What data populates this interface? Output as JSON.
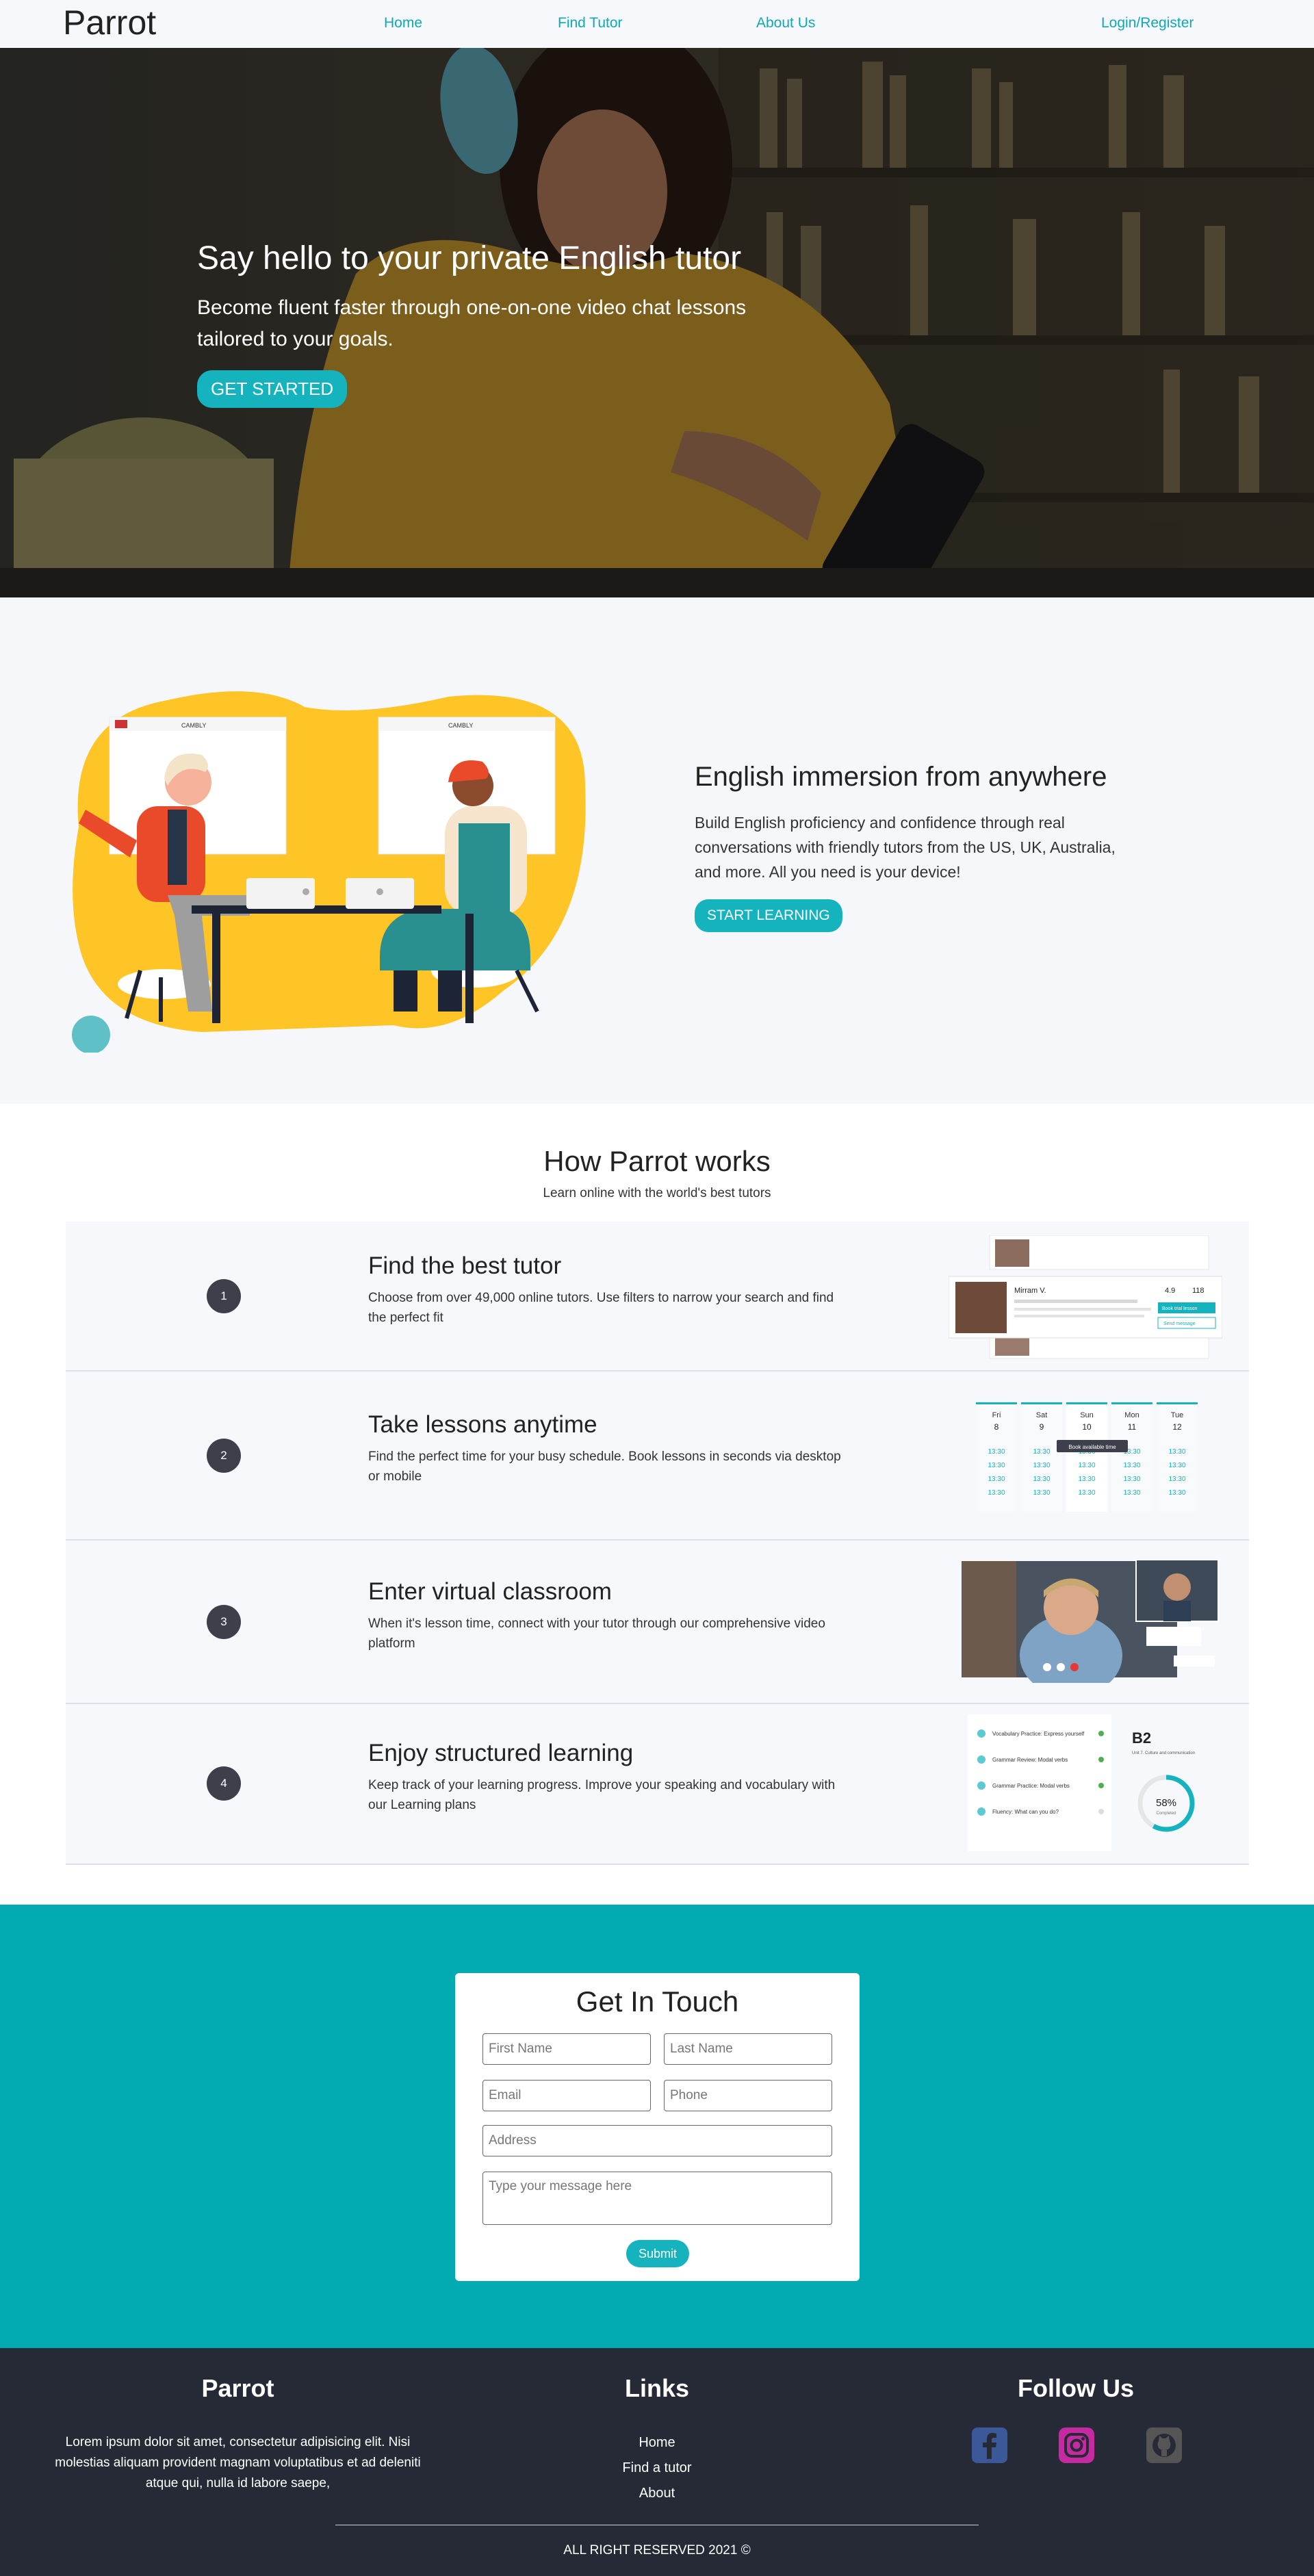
{
  "nav": {
    "brand": "Parrot",
    "home": "Home",
    "find_tutor": "Find Tutor",
    "about": "About Us",
    "login": "Login/Register"
  },
  "hero": {
    "title": "Say hello to your private English tutor",
    "subtitle": "Become fluent faster through one-on-one video chat lessons tailored to your goals.",
    "cta": "GET STARTED"
  },
  "immersion": {
    "title": "English immersion from anywhere",
    "text": "Build English proficiency and confidence through real conversations with friendly tutors from the US, UK, Australia, and more. All you need is your device!",
    "cta": "START LEARNING",
    "window_brand": "CAMBLY"
  },
  "how": {
    "title": "How Parrot works",
    "subtitle": "Learn online with the world's best tutors",
    "steps": [
      {
        "num": "1",
        "title": "Find the best tutor",
        "desc": "Choose from over 49,000 online tutors. Use filters to narrow your search and find the perfect fit"
      },
      {
        "num": "2",
        "title": "Take lessons anytime",
        "desc": "Find the perfect time for your busy schedule. Book lessons in seconds via desktop or mobile"
      },
      {
        "num": "3",
        "title": "Enter virtual classroom",
        "desc": "When it's lesson time, connect with your tutor through our comprehensive video platform"
      },
      {
        "num": "4",
        "title": "Enjoy structured learning",
        "desc": "Keep track of your learning progress. Improve your speaking and vocabulary with our Learning plans"
      }
    ],
    "tutor_card": {
      "name": "Mirram V.",
      "rating": "4.9",
      "lessons": "118",
      "book": "Book trial lesson",
      "message": "Send message"
    },
    "schedule": {
      "days": [
        "Fri",
        "Sat",
        "Sun",
        "Mon",
        "Tue"
      ],
      "dates": [
        "8",
        "9",
        "10",
        "11",
        "12"
      ],
      "times": [
        "13:30",
        "13:30",
        "13:30",
        "13:30"
      ],
      "tooltip": "Book available time"
    },
    "learning": {
      "level": "B2",
      "level_desc": "Unit 7. Culture and communication",
      "progress": "58%",
      "progress_label": "Completed",
      "progress_value": 0.58,
      "items": [
        "Vocabulary Practice: Express yourself",
        "Grammar Review: Modal verbs",
        "Grammar Practice: Modal verbs",
        "Fluency: What can you do?"
      ]
    }
  },
  "contact": {
    "title": "Get In Touch",
    "first_name": "First Name",
    "last_name": "Last Name",
    "email": "Email",
    "phone": "Phone",
    "address": "Address",
    "message": "Type your message here",
    "submit": "Submit"
  },
  "footer": {
    "brand": "Parrot",
    "about": "Lorem ipsum dolor sit amet, consectetur adipisicing elit. Nisi molestias aliquam provident magnam voluptatibus et ad deleniti atque qui, nulla id labore saepe,",
    "links_title": "Links",
    "links": [
      "Home",
      "Find a tutor",
      "About"
    ],
    "follow_title": "Follow Us",
    "copyright": "ALL RIGHT RESERVED 2021 ©"
  },
  "colors": {
    "accent": "#15b3bd",
    "contact_bg": "#00aab0",
    "footer_bg": "#262a36",
    "nav_link": "#10a8b4",
    "facebook": "#3b5998",
    "instagram": "#c62aa0",
    "github": "#555555"
  }
}
